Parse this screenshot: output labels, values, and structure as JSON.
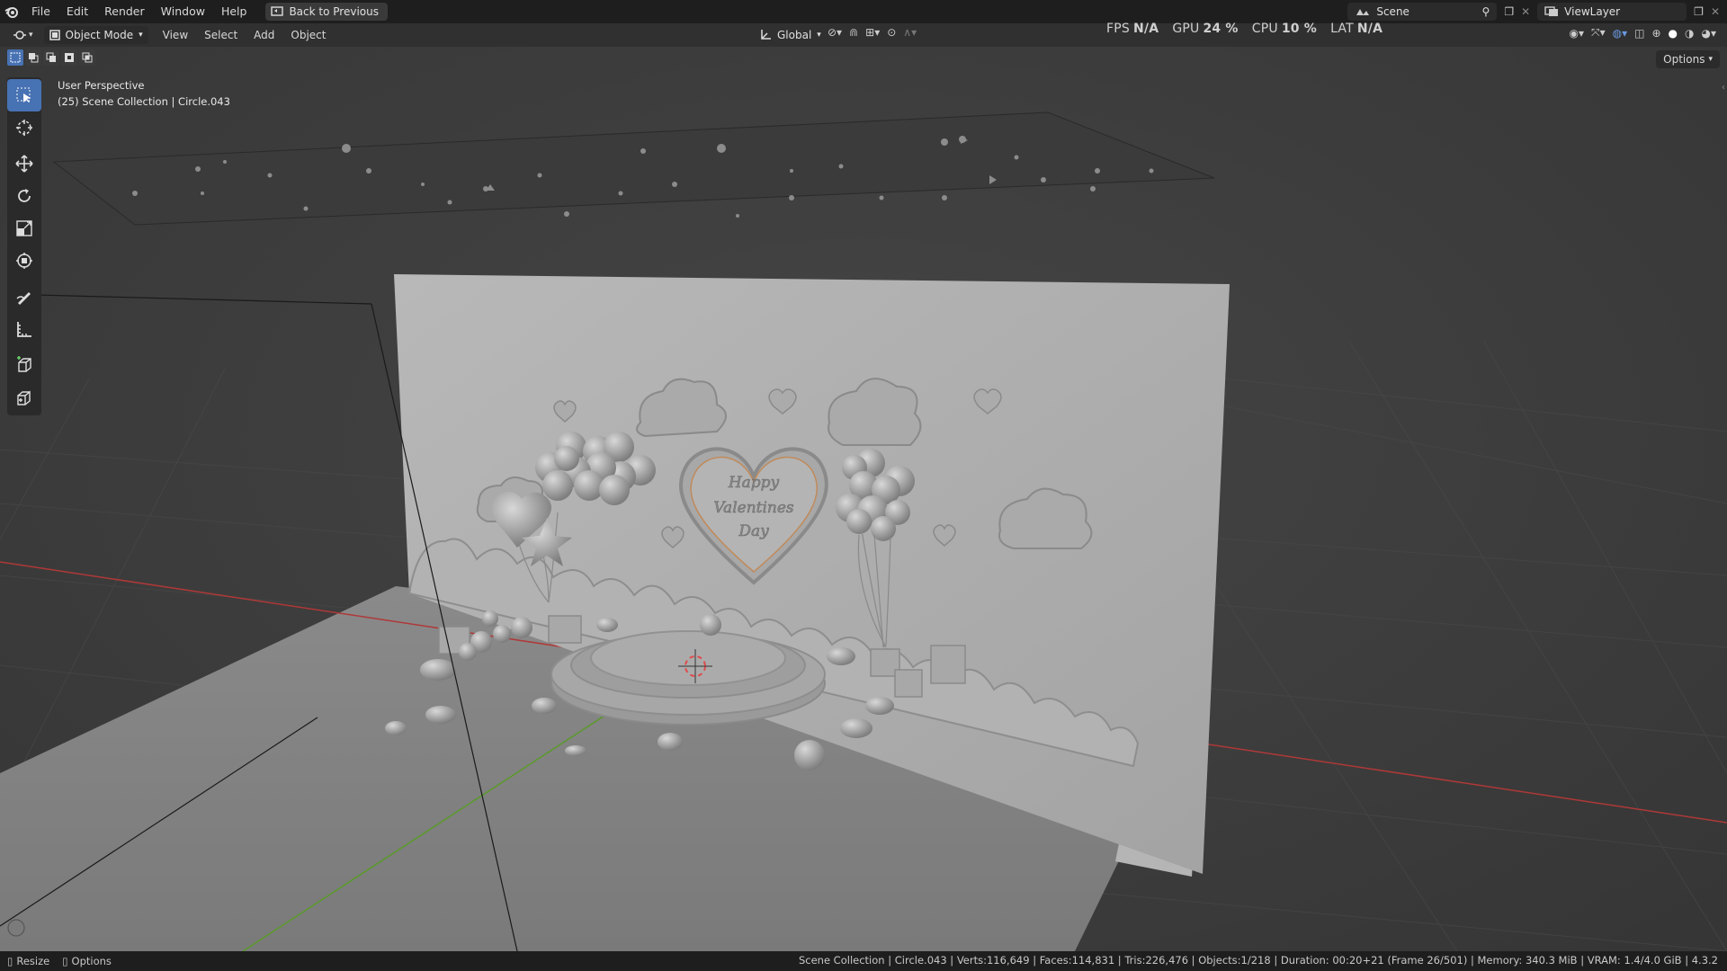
{
  "menu": {
    "items": [
      "File",
      "Edit",
      "Render",
      "Window",
      "Help"
    ],
    "back_label": "Back to Previous"
  },
  "top_right": {
    "scene_label": "Scene",
    "view_layer_label": "ViewLayer"
  },
  "header": {
    "mode_label": "Object Mode",
    "menus": [
      "View",
      "Select",
      "Add",
      "Object"
    ],
    "transform_orientation": "Global"
  },
  "stats": {
    "fps_label": "FPS",
    "fps_value": "N/A",
    "gpu_label": "GPU",
    "gpu_value": "24 %",
    "cpu_label": "CPU",
    "cpu_value": "10 %",
    "lat_label": "LAT",
    "lat_value": "N/A"
  },
  "viewport": {
    "perspective_label": "User Perspective",
    "collection_label": "(25) Scene Collection | Circle.043",
    "options_label": "Options",
    "sign_text": [
      "Happy",
      "Valentines",
      "Day"
    ]
  },
  "status": {
    "resize_label": "Resize",
    "options_label": "Options",
    "info": "Scene Collection | Circle.043 | Verts:116,649 | Faces:114,831 | Tris:226,476 | Objects:1/218 | Duration: 00:20+21 (Frame 26/501) | Memory: 340.3 MiB | VRAM: 1.4/4.0 GiB | 4.3.2"
  },
  "colors": {
    "accent": "#4772b3",
    "topbar": "#1e1e1e",
    "header": "#303030",
    "viewport": "#3d3d3d",
    "x_axis": "#b03838",
    "y_axis": "#5a9a2a"
  },
  "icons": {
    "logo": "blender-logo-icon",
    "tools": [
      "select-box-icon",
      "cursor-icon",
      "move-icon",
      "rotate-icon",
      "scale-icon",
      "transform-icon",
      "annotate-icon",
      "measure-icon",
      "add-cube-icon",
      "extrude-icon"
    ]
  }
}
